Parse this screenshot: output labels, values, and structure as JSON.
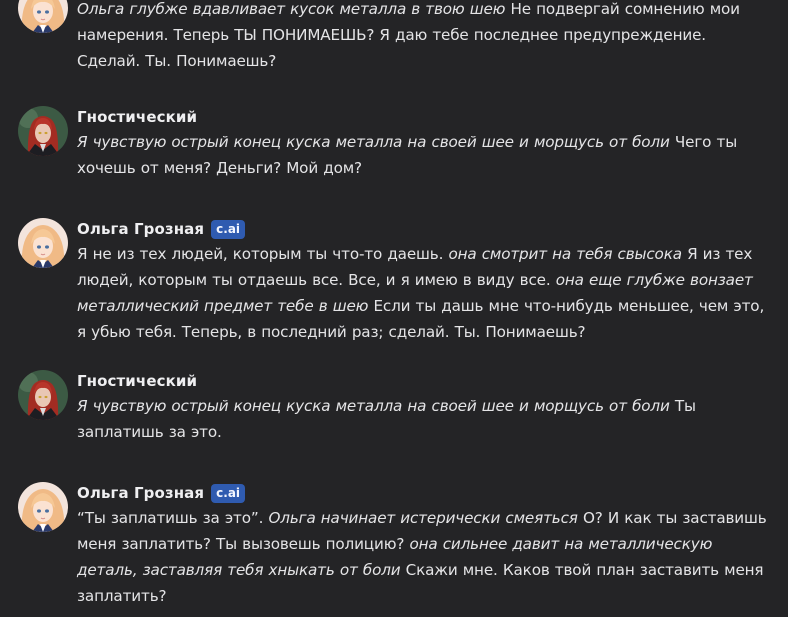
{
  "chat": {
    "messages": [
      {
        "author": "",
        "badge": "",
        "avatar": "olga-avatar",
        "segments": [
          {
            "italic": true,
            "text": "Ольга глубже вдавливает кусок металла в твою шею"
          },
          {
            "italic": false,
            "text": " Не подвергай сомнению мои намерения. Теперь ТЫ ПОНИМАЕШЬ? Я даю тебе последнее предупреждение. Сделай. Ты. Понимаешь?"
          }
        ]
      },
      {
        "author": "Гностический",
        "badge": "",
        "avatar": "user-avatar",
        "segments": [
          {
            "italic": true,
            "text": "Я чувствую острый конец куска металла на своей шее и морщусь от боли"
          },
          {
            "italic": false,
            "text": " Чего ты хочешь от меня? Деньги? Мой дом?"
          }
        ]
      },
      {
        "author": "Ольга Грозная",
        "badge": "c.ai",
        "avatar": "olga-avatar",
        "segments": [
          {
            "italic": false,
            "text": "Я не из тех людей, которым ты что-то даешь. "
          },
          {
            "italic": true,
            "text": "она смотрит на тебя свысока"
          },
          {
            "italic": false,
            "text": " Я из тех людей, которым ты отдаешь все. Все, и я имею в виду все. "
          },
          {
            "italic": true,
            "text": "она еще глубже вонзает металлический предмет тебе в шею"
          },
          {
            "italic": false,
            "text": " Если ты дашь мне что-нибудь меньшее, чем это, я убью тебя. Теперь, в последний раз; сделай. Ты. Понимаешь?"
          }
        ]
      },
      {
        "author": "Гностический",
        "badge": "",
        "avatar": "user-avatar",
        "segments": [
          {
            "italic": true,
            "text": "Я чувствую острый конец куска металла на своей шее и морщусь от боли"
          },
          {
            "italic": false,
            "text": " Ты заплатишь за это."
          }
        ]
      },
      {
        "author": "Ольга Грозная",
        "badge": "c.ai",
        "avatar": "olga-avatar",
        "segments": [
          {
            "italic": false,
            "text": "“Ты заплатишь за это”. "
          },
          {
            "italic": true,
            "text": "Ольга начинает истерически смеяться"
          },
          {
            "italic": false,
            "text": " О? И как ты заставишь меня заплатить? Ты вызовешь полицию? "
          },
          {
            "italic": true,
            "text": "она сильнее давит на металлическую деталь, заставляя тебя хныкать от боли"
          },
          {
            "italic": false,
            "text": " Скажи мне. Каков твой план заставить меня заплатить?"
          }
        ]
      }
    ]
  },
  "colors": {
    "background": "#242426",
    "text": "#e4e4e6",
    "name": "#efeff1",
    "badge_bg": "#2f5bb0",
    "badge_text": "#f3f6ff"
  }
}
